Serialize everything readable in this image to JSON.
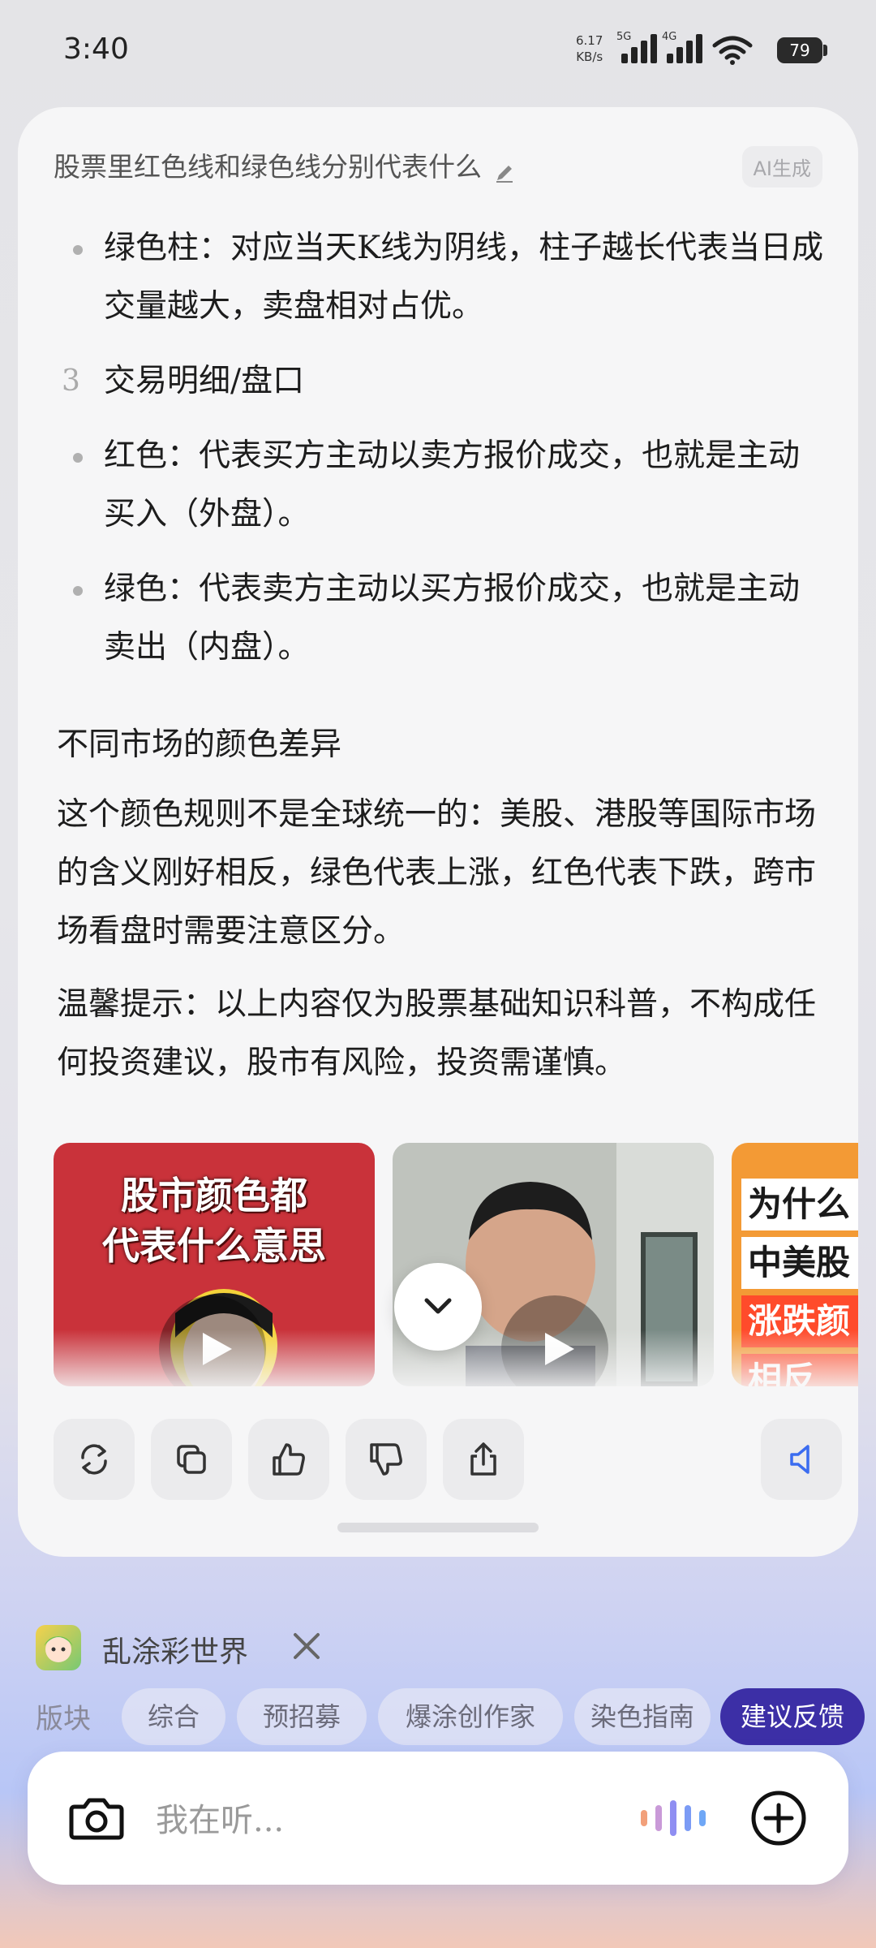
{
  "status_bar": {
    "time": "3:40",
    "net_speed": "6.17",
    "net_unit": "KB/s",
    "sim1": "5G",
    "sim2": "4G",
    "battery": "79"
  },
  "card": {
    "question": "股票里红色线和绿色线分别代表什么",
    "ai_tag": "AI生成",
    "blocks": {
      "b1": "绿色柱：对应当天K线为阴线，柱子越长代表当日成交量越大，卖盘相对占优。",
      "n3_num": "3",
      "n3_text": "交易明细/盘口",
      "b2": "红色：代表买方主动以卖方报价成交，也就是主动买入（外盘）。",
      "b3": "绿色：代表卖方主动以买方报价成交，也就是主动卖出（内盘）。",
      "section": "不同市场的颜色差异",
      "p1": "这个颜色规则不是全球统一的：美股、港股等国际市场的含义刚好相反，绿色代表上涨，红色代表下跌，跨市场看盘时需要注意区分。",
      "p2": "温馨提示：以上内容仅为股票基础知识科普，不构成任何投资建议，股市有风险，投资需谨慎。"
    },
    "videos": [
      {
        "title_line1": "股市颜色都",
        "title_line2": "代表什么意思"
      },
      {
        "title_line1": "",
        "title_line2": ""
      },
      {
        "title_line1": "为什么",
        "title_line2": "中美股",
        "title_line3": "涨跌颜",
        "title_line4": "相反"
      }
    ],
    "actions": [
      "regenerate-icon",
      "copy-icon",
      "thumbs-up-icon",
      "thumbs-down-icon",
      "share-icon",
      "speaker-icon"
    ]
  },
  "app": {
    "name": "乱涂彩世界"
  },
  "tags": {
    "lead": "版块",
    "items": [
      "综合",
      "预招募",
      "爆涂创作家",
      "染色指南"
    ],
    "primary": "建议反馈"
  },
  "input": {
    "placeholder": "我在听..."
  },
  "colors": {
    "accent": "#3c2fa6",
    "speaker_blue": "#3b6cf0",
    "video_red": "#c9323a",
    "video_orange": "#f39a35"
  }
}
